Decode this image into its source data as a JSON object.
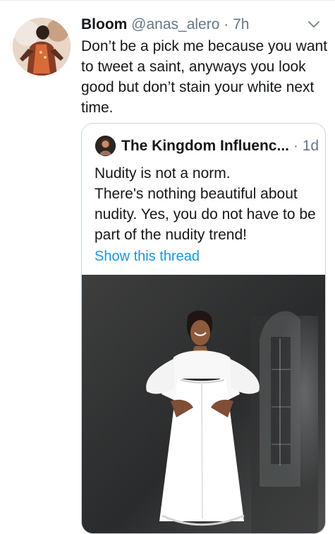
{
  "tweet": {
    "author_name": "Bloom",
    "author_handle": "@anas_alero",
    "separator": "·",
    "time": "7h",
    "text": "Don’t be a pick me because you want to tweet a saint, anyways you look good but don’t stain your white next time.",
    "icons": {
      "more": "chevron-down-icon",
      "avatar": "avatar-image"
    }
  },
  "quoted": {
    "author_name": "The Kingdom Influenc...",
    "separator": "·",
    "time": "1d",
    "text": "Nudity is not a norm.\nThere's nothing beautiful about nudity. Yes, you do not have to be part of the nudity trend!",
    "thread_link": "Show this thread",
    "media": "photo of woman in white dress",
    "colors": {
      "link": "#1b95e0",
      "muted": "#657786",
      "border": "#ccd6dd"
    }
  }
}
